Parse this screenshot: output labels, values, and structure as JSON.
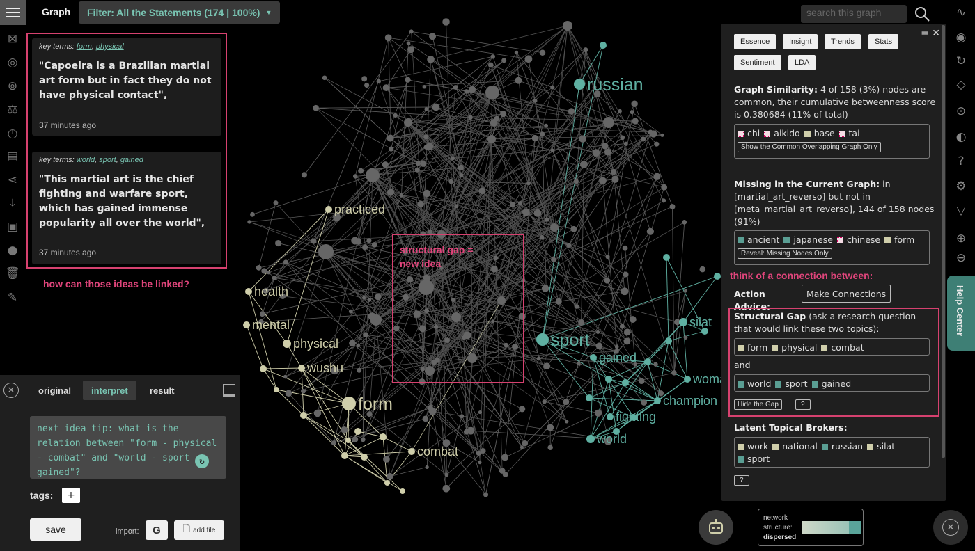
{
  "app": {
    "view_title": "Graph",
    "filter_label": "Filter: All the Statements (174 | 100%)",
    "search_placeholder": "search this graph"
  },
  "statements": [
    {
      "key_terms_prefix": "key terms:",
      "terms": [
        "form",
        "physical"
      ],
      "text": "\"Capoeira is a Brazilian martial art form but in fact they do not have physical contact\",",
      "time": "37 minutes ago"
    },
    {
      "key_terms_prefix": "key terms:",
      "terms": [
        "world",
        "sport",
        "gained"
      ],
      "text": "\"This martial art is the chief fighting and warfare sport, which has gained immense popularity all over the world\",",
      "time": "37 minutes ago"
    }
  ],
  "annotations": {
    "link_question": "how can those ideas be linked?",
    "gap_label": "structural gap =\nnew idea",
    "connection_prompt": "think of a connection between:"
  },
  "editor": {
    "tabs": [
      "original",
      "interpret",
      "result"
    ],
    "active_tab": "interpret",
    "tip_text": "next idea tip: what is the relation between \"form - physical - combat\" and \"world - sport - gained\"?",
    "tags_label": "tags:",
    "add_tag": "+",
    "save_label": "save",
    "import_label": "import:",
    "google_label": "G",
    "add_file_label": "add file"
  },
  "panel": {
    "tabs_row1": [
      "Essence",
      "Insight",
      "Trends",
      "Stats"
    ],
    "tabs_row2": [
      "Sentiment",
      "LDA"
    ],
    "similarity_title": "Graph Similarity:",
    "similarity_text": "4 of 158 (3%) nodes are common, their cumulative betweenness score is 0.380684 (11% of total)",
    "common_nodes": [
      "chi",
      "aikido",
      "base",
      "tai"
    ],
    "common_nodes_colors": [
      "pink",
      "pink",
      "beige",
      "pink"
    ],
    "common_button": "Show the Common Overlapping Graph Only",
    "missing_title": "Missing in the Current Graph:",
    "missing_text": "in [martial_art_reverso] but not in [meta_martial_art_reverso], 144 of 158 nodes (91%)",
    "missing_nodes": [
      "ancient",
      "japanese",
      "chinese",
      "form"
    ],
    "missing_nodes_colors": [
      "teal",
      "teal",
      "pink",
      "beige"
    ],
    "missing_button": "Reveal: Missing Nodes Only",
    "action_label": "Action Advice:",
    "action_button": "Make Connections",
    "gap_title": "Structural Gap",
    "gap_text": "(ask a research question that would link these two topics):",
    "gap_group1": [
      "form",
      "physical",
      "combat"
    ],
    "gap_group1_colors": [
      "beige",
      "beige",
      "beige"
    ],
    "gap_and": "and",
    "gap_group2": [
      "world",
      "sport",
      "gained"
    ],
    "gap_group2_colors": [
      "teal",
      "teal",
      "teal"
    ],
    "hide_gap": "Hide the Gap",
    "help_q": "?",
    "brokers_title": "Latent Topical Brokers:",
    "brokers": [
      "work",
      "national",
      "russian",
      "silat",
      "sport"
    ],
    "brokers_colors": [
      "beige",
      "beige",
      "teal",
      "beige",
      "teal"
    ]
  },
  "help_center": "Help Center",
  "network": {
    "label": "network structure:",
    "value": "dispersed"
  },
  "graph_labels": [
    {
      "text": "russian",
      "color": "#5fb0a2",
      "size": "big"
    },
    {
      "text": "practiced",
      "color": "#cfceaa",
      "size": "mid"
    },
    {
      "text": "health",
      "color": "#cfceaa",
      "size": "mid"
    },
    {
      "text": "mental",
      "color": "#cfceaa",
      "size": "mid"
    },
    {
      "text": "physical",
      "color": "#cfceaa",
      "size": "mid"
    },
    {
      "text": "wushu",
      "color": "#cfceaa",
      "size": "mid"
    },
    {
      "text": "form",
      "color": "#cfceaa",
      "size": "big"
    },
    {
      "text": "combat",
      "color": "#cfceaa",
      "size": "mid"
    },
    {
      "text": "sport",
      "color": "#5fb0a2",
      "size": "big"
    },
    {
      "text": "gained",
      "color": "#5fb0a2",
      "size": "mid"
    },
    {
      "text": "fighting",
      "color": "#5fb0a2",
      "size": "mid"
    },
    {
      "text": "world",
      "color": "#5fb0a2",
      "size": "mid"
    },
    {
      "text": "champion",
      "color": "#5fb0a2",
      "size": "mid"
    },
    {
      "text": "woma",
      "color": "#5fb0a2",
      "size": "mid"
    },
    {
      "text": "silat",
      "color": "#5fb0a2",
      "size": "mid"
    }
  ],
  "colors": {
    "accent_teal": "#79c4b2",
    "highlight_pink": "#d6416f",
    "node_beige": "#cfceaa",
    "node_teal": "#5fb0a2",
    "node_grey": "#666666"
  }
}
